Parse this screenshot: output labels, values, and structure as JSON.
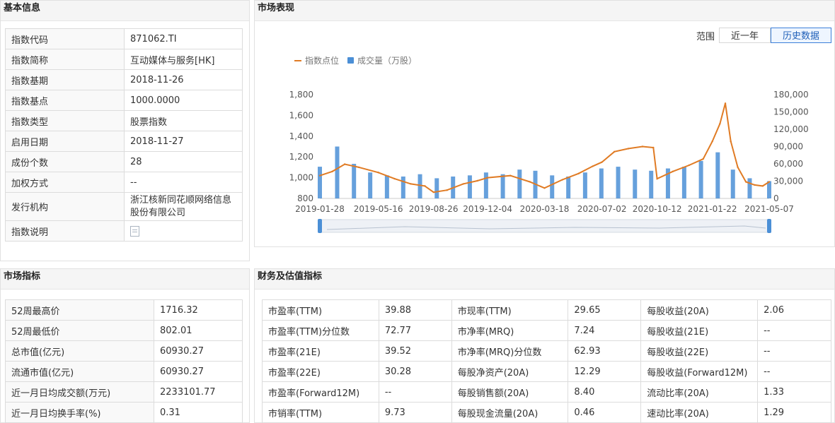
{
  "basic": {
    "title": "基本信息",
    "rows": [
      {
        "k": "指数代码",
        "v": "871062.TI"
      },
      {
        "k": "指数简称",
        "v": "互动媒体与服务[HK]"
      },
      {
        "k": "指数基期",
        "v": "2018-11-26"
      },
      {
        "k": "指数基点",
        "v": "1000.0000"
      },
      {
        "k": "指数类型",
        "v": "股票指数"
      },
      {
        "k": "启用日期",
        "v": "2018-11-27"
      },
      {
        "k": "成份个数",
        "v": "28"
      },
      {
        "k": "加权方式",
        "v": "--"
      },
      {
        "k": "发行机构",
        "v": "浙江核新同花顺网络信息股份有限公司"
      },
      {
        "k": "指数说明",
        "v": "",
        "icon": "document-icon"
      }
    ]
  },
  "market": {
    "title": "市场表现",
    "range_label": "范围",
    "buttons": [
      "近一年",
      "历史数据"
    ],
    "active_button": "历史数据"
  },
  "indicators": {
    "title": "市场指标",
    "rows": [
      {
        "k": "52周最高价",
        "v": "1716.32"
      },
      {
        "k": "52周最低价",
        "v": "802.01"
      },
      {
        "k": "总市值(亿元)",
        "v": "60930.27"
      },
      {
        "k": "流通市值(亿元)",
        "v": "60930.27"
      },
      {
        "k": "近一月日均成交额(万元)",
        "v": "2233101.77"
      },
      {
        "k": "近一月日均换手率(%)",
        "v": "0.31"
      }
    ]
  },
  "finance": {
    "title": "财务及估值指标",
    "rows": [
      [
        "市盈率(TTM)",
        "39.88",
        "市现率(TTM)",
        "29.65",
        "每股收益(20A)",
        "2.06"
      ],
      [
        "市盈率(TTM)分位数",
        "72.77",
        "市净率(MRQ)",
        "7.24",
        "每股收益(21E)",
        "--"
      ],
      [
        "市盈率(21E)",
        "39.52",
        "市净率(MRQ)分位数",
        "62.93",
        "每股收益(22E)",
        "--"
      ],
      [
        "市盈率(22E)",
        "30.28",
        "每股净资产(20A)",
        "12.29",
        "每股收益(Forward12M)",
        "--"
      ],
      [
        "市盈率(Forward12M)",
        "--",
        "每股销售额(20A)",
        "8.40",
        "流动比率(20A)",
        "1.33"
      ],
      [
        "市销率(TTM)",
        "9.73",
        "每股现金流量(20A)",
        "0.46",
        "速动比率(20A)",
        "1.29"
      ]
    ]
  },
  "colors": {
    "line": "#e07b24",
    "bar": "#4b8fd6",
    "accent": "#3d80d9"
  },
  "chart_data": {
    "type": "line",
    "legend": [
      "指数点位",
      "成交量（万股）"
    ],
    "legend_placement": "top-left",
    "x_ticks": [
      "2019-01-28",
      "2019-05-16",
      "2019-08-26",
      "2019-12-04",
      "2020-03-18",
      "2020-07-02",
      "2020-10-12",
      "2021-01-22",
      "2021-05-07"
    ],
    "y_left_ticks": [
      "800",
      "1,000",
      "1,200",
      "1,400",
      "1,600",
      "1,800"
    ],
    "y_right_ticks": [
      "0",
      "30,000",
      "60,000",
      "90,000",
      "120,000",
      "150,000",
      "180,000"
    ],
    "y_left_range": [
      800,
      1800
    ],
    "y_right_range": [
      0,
      180000
    ],
    "grid": false,
    "series": [
      {
        "name": "指数点位",
        "type": "line",
        "axis": "left",
        "x": [
          "2019-01-28",
          "2019-02-20",
          "2019-03-15",
          "2019-04-10",
          "2019-05-16",
          "2019-06-15",
          "2019-07-15",
          "2019-08-10",
          "2019-08-26",
          "2019-09-20",
          "2019-10-20",
          "2019-11-15",
          "2019-12-04",
          "2020-01-15",
          "2020-02-20",
          "2020-03-18",
          "2020-04-20",
          "2020-05-20",
          "2020-06-15",
          "2020-07-02",
          "2020-07-25",
          "2020-08-20",
          "2020-09-15",
          "2020-10-05",
          "2020-10-12",
          "2020-11-10",
          "2020-12-10",
          "2021-01-05",
          "2021-01-22",
          "2021-02-05",
          "2021-02-15",
          "2021-02-25",
          "2021-03-10",
          "2021-03-25",
          "2021-04-10",
          "2021-04-25",
          "2021-05-07"
        ],
        "values": [
          1020,
          1060,
          1130,
          1100,
          1050,
          990,
          940,
          920,
          860,
          880,
          940,
          970,
          1000,
          1020,
          960,
          900,
          980,
          1040,
          1110,
          1150,
          1250,
          1280,
          1300,
          1290,
          990,
          1060,
          1120,
          1180,
          1350,
          1520,
          1716,
          1350,
          1100,
          960,
          930,
          920,
          960
        ]
      },
      {
        "name": "成交量（万股）",
        "type": "bar",
        "axis": "right",
        "x": [
          "2019-01-28",
          "2019-03-01",
          "2019-04-01",
          "2019-05-01",
          "2019-06-01",
          "2019-07-01",
          "2019-08-01",
          "2019-09-01",
          "2019-10-01",
          "2019-11-01",
          "2019-12-01",
          "2020-01-01",
          "2020-02-01",
          "2020-03-01",
          "2020-04-01",
          "2020-05-01",
          "2020-06-01",
          "2020-07-01",
          "2020-08-01",
          "2020-09-01",
          "2020-10-01",
          "2020-11-01",
          "2020-12-01",
          "2021-01-01",
          "2021-02-01",
          "2021-03-01",
          "2021-04-01",
          "2021-05-07"
        ],
        "values": [
          55000,
          90000,
          60000,
          45000,
          40000,
          38000,
          42000,
          35000,
          38000,
          40000,
          45000,
          42000,
          50000,
          48000,
          40000,
          38000,
          45000,
          52000,
          55000,
          50000,
          48000,
          52000,
          55000,
          65000,
          80000,
          50000,
          35000,
          30000
        ]
      }
    ]
  }
}
